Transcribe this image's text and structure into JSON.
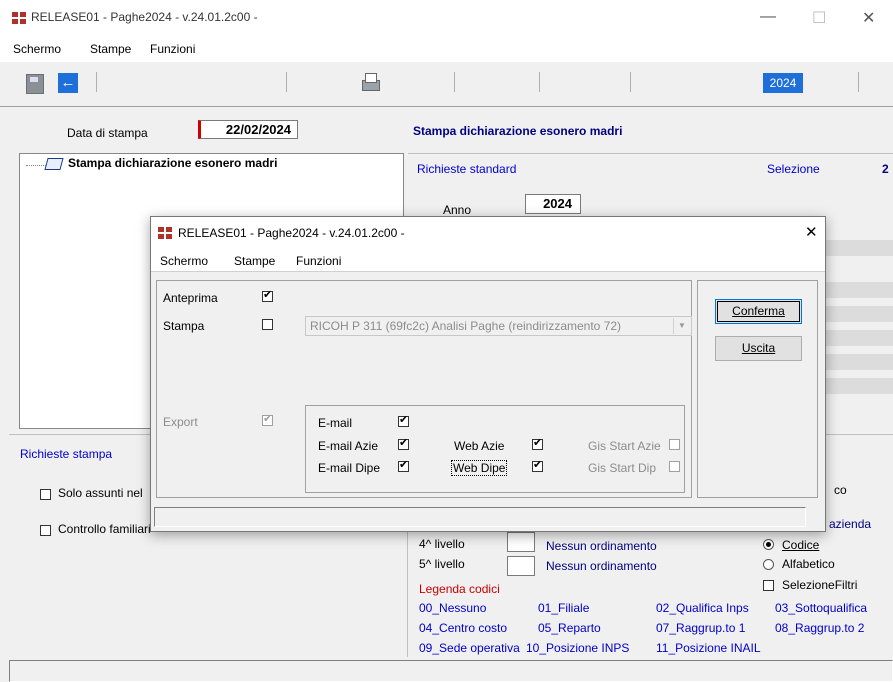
{
  "window": {
    "title": "RELEASE01 - Paghe2024 - v.24.01.2c00 -",
    "minimize": "—",
    "maximize": "☐",
    "close": "✕"
  },
  "menu": [
    "Schermo",
    "Stampe",
    "Funzioni"
  ],
  "toolbar": {
    "year": "2024"
  },
  "main": {
    "print_date_label": "Data di stampa",
    "print_date_value": "22/02/2024",
    "heading": "Stampa dichiarazione esonero madri",
    "tree_item": "Stampa dichiarazione esonero madri",
    "standard_requests": "Richieste standard",
    "selection_label": "Selezione",
    "selection_value": "2",
    "year_label": "Anno",
    "year_value": "2024"
  },
  "print_requests": {
    "title": "Richieste stampa",
    "opt1": "Solo assunti nel",
    "opt2": "Controllo familiari"
  },
  "right_panel": {
    "frag_co": "co",
    "frag_azienda": "azienda",
    "level4_label": "4^ livello",
    "level4_value": "Nessun ordinamento",
    "level5_label": "5^ livello",
    "level5_value": "Nessun ordinamento",
    "radio_codice": "Codice",
    "radio_alfabetico": "Alfabetico",
    "selezione_filtri": "SelezioneFiltri",
    "legend_title": "Legenda codici",
    "legend": [
      [
        "00_Nessuno",
        "01_Filiale",
        "02_Qualifica Inps",
        "03_Sottoqualifica"
      ],
      [
        "04_Centro costo",
        "05_Reparto",
        "07_Raggrup.to 1",
        "08_Raggrup.to 2"
      ],
      [
        "09_Sede operativa",
        "10_Posizione INPS",
        "11_Posizione INAIL",
        ""
      ]
    ]
  },
  "dialog": {
    "title": "RELEASE01 - Paghe2024 - v.24.01.2c00 -",
    "close": "✕",
    "menu": [
      "Schermo",
      "Stampe",
      "Funzioni"
    ],
    "anteprima": "Anteprima",
    "stampa": "Stampa",
    "printer": "RICOH P 311 (69fc2c) Analisi Paghe (reindirizzamento 72)",
    "export": "Export",
    "email": "E-mail",
    "email_azie": "E-mail Azie",
    "email_dipe": "E-mail Dipe",
    "web_azie": "Web Azie",
    "web_dipe": "Web Dipe",
    "gis_start_azie": "Gis Start Azie",
    "gis_start_dip": "Gis Start Dip",
    "conferma": "Conferma",
    "uscita": "Uscita"
  }
}
